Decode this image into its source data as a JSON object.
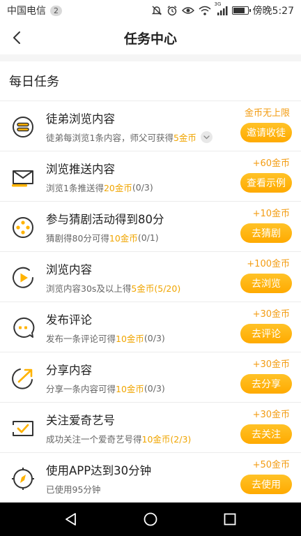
{
  "status_bar": {
    "carrier": "中国电信",
    "sim_badge": "2",
    "network_label": "3G",
    "time": "傍晚5:27",
    "battery_level": 0.85
  },
  "header": {
    "title": "任务中心"
  },
  "section": {
    "title": "每日任务"
  },
  "colors": {
    "accent": "#ffb300",
    "reward_text": "#f39c12",
    "highlight": "#f0a500"
  },
  "tasks": [
    {
      "icon": "apprentice-icon",
      "title": "徒弟浏览内容",
      "desc_pre": "徒弟每浏览1条内容，师父可获得",
      "desc_hl": "5金币",
      "desc_post": "",
      "reward": "金币无上限",
      "button": "邀请收徒"
    },
    {
      "icon": "envelope-icon",
      "title": "浏览推送内容",
      "desc_pre": "浏览1条推送得",
      "desc_hl": "20金币",
      "desc_post": "(0/3)",
      "reward": "+60金币",
      "button": "查看示例"
    },
    {
      "icon": "dice-icon",
      "title": "参与猜剧活动得到80分",
      "desc_pre": "猜剧得80分可得",
      "desc_hl": "10金币",
      "desc_post": "(0/1)",
      "reward": "+10金币",
      "button": "去猜剧"
    },
    {
      "icon": "play-icon",
      "title": "浏览内容",
      "desc_pre": "浏览内容30s及以上得",
      "desc_hl": "5金币(5/20)",
      "desc_post": "",
      "reward": "+100金币",
      "button": "去浏览"
    },
    {
      "icon": "comment-icon",
      "title": "发布评论",
      "desc_pre": "发布一条评论可得",
      "desc_hl": "10金币",
      "desc_post": "(0/3)",
      "reward": "+30金币",
      "button": "去评论"
    },
    {
      "icon": "share-icon",
      "title": "分享内容",
      "desc_pre": "分享一条内容可得",
      "desc_hl": "10金币",
      "desc_post": "(0/3)",
      "reward": "+30金币",
      "button": "去分享"
    },
    {
      "icon": "follow-icon",
      "title": "关注爱奇艺号",
      "desc_pre": "成功关注一个爱奇艺号得",
      "desc_hl": "10金币(2/3)",
      "desc_post": "",
      "reward": "+30金币",
      "button": "去关注"
    },
    {
      "icon": "compass-icon",
      "title": "使用APP达到30分钟",
      "desc_pre": "已使用95分钟",
      "desc_hl": "",
      "desc_post": "",
      "reward": "+50金币",
      "button": "去使用"
    }
  ],
  "nav_bar": {
    "back_icon": "nav-back-icon",
    "home_icon": "nav-home-icon",
    "recents_icon": "nav-recents-icon"
  }
}
